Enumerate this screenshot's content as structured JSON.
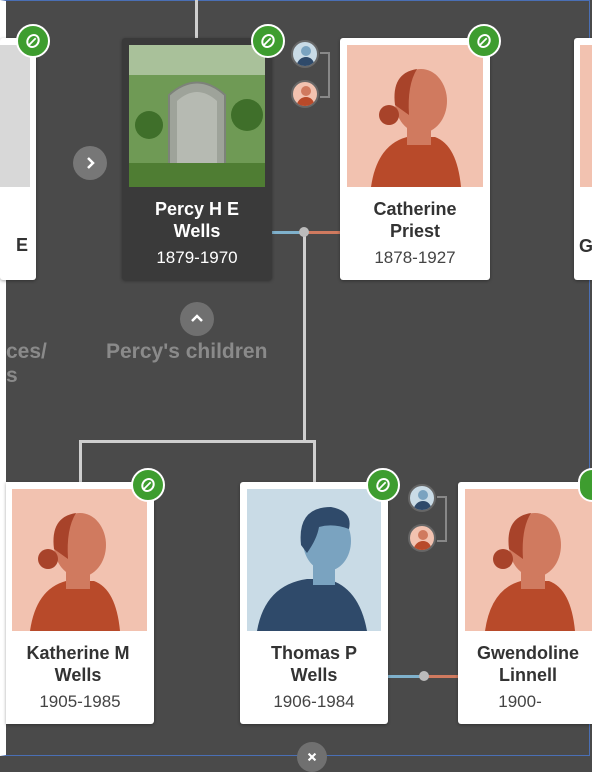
{
  "people": {
    "left_partial": {
      "name": "E"
    },
    "percy": {
      "name": "Percy H E Wells",
      "dates": "1879-1970"
    },
    "catherine": {
      "name": "Catherine Priest",
      "dates": "1878-1927"
    },
    "right_partial": {
      "name": "G"
    },
    "katherine": {
      "name": "Katherine M Wells",
      "dates": "1905-1985"
    },
    "thomas": {
      "name": "Thomas P Wells",
      "dates": "1906-1984"
    },
    "gwendoline": {
      "name": "Gwendoline Linnell",
      "dates": "1900-"
    }
  },
  "labels": {
    "children": "Percy's children",
    "left_fragment_1": "ces/",
    "left_fragment_2": "s"
  },
  "colors": {
    "background": "#4a4a4a",
    "leaf": "#3e9d2f",
    "female_bg": "#f2c2b0",
    "female_skin": "#d07a5f",
    "female_body": "#b84a2a",
    "male_bg": "#c9dbe6",
    "male_skin": "#7aa3c0",
    "male_body": "#2f4a6a"
  },
  "icons": {
    "leaf": "ancestry-hint-leaf-icon",
    "chevron_right": "chevron-right-icon",
    "chevron_up": "chevron-up-icon",
    "chevron_down": "chevron-down-icon"
  }
}
